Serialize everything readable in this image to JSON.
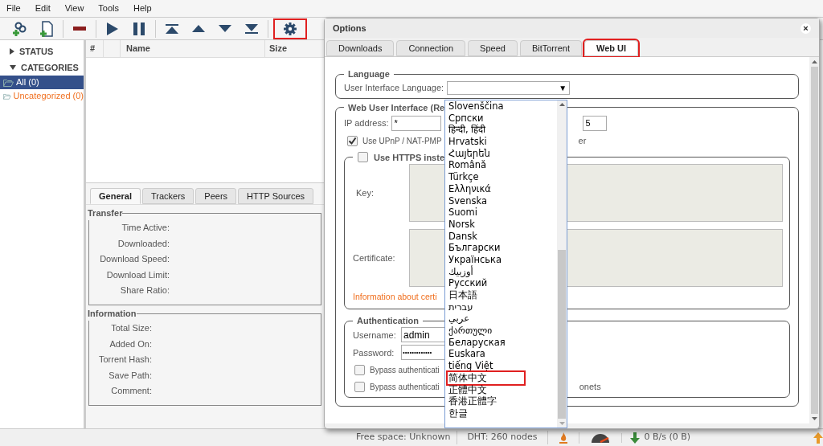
{
  "menu": [
    "File",
    "Edit",
    "View",
    "Tools",
    "Help"
  ],
  "toolbar": [
    [
      {
        "kind": "add-link",
        "highlighted": false
      },
      {
        "kind": "add-file",
        "highlighted": false
      }
    ],
    [
      {
        "kind": "remove",
        "highlighted": false
      }
    ],
    [
      {
        "kind": "play",
        "highlighted": false
      },
      {
        "kind": "pause",
        "highlighted": false
      }
    ],
    [
      {
        "kind": "top",
        "highlighted": false
      },
      {
        "kind": "up",
        "highlighted": false
      },
      {
        "kind": "down",
        "highlighted": false
      },
      {
        "kind": "bottom",
        "highlighted": false
      }
    ],
    [
      {
        "kind": "settings",
        "highlighted": true
      }
    ]
  ],
  "sidebar": {
    "sections": [
      {
        "label": "STATUS",
        "expanded": false
      },
      {
        "label": "CATEGORIES",
        "expanded": true
      }
    ],
    "items": [
      {
        "label": "All (0)",
        "selected": true
      },
      {
        "label": "Uncategorized (0)",
        "selected": false
      }
    ]
  },
  "table": {
    "columns": [
      "#",
      "Name",
      "Size"
    ]
  },
  "details": {
    "tabs": [
      {
        "label": "General",
        "selected": true
      },
      {
        "label": "Trackers",
        "selected": false
      },
      {
        "label": "Peers",
        "selected": false
      },
      {
        "label": "HTTP Sources",
        "selected": false
      }
    ],
    "groups": [
      {
        "title": "Transfer",
        "fields": [
          "Time Active:",
          "Downloaded:",
          "Download Speed:",
          "Download Limit:",
          "Share Ratio:"
        ]
      },
      {
        "title": "Information",
        "fields": [
          "Total Size:",
          "Added On:",
          "Torrent Hash:",
          "Save Path:",
          "Comment:"
        ]
      }
    ]
  },
  "dialog": {
    "title": "Options",
    "close": "×",
    "tabs": [
      {
        "label": "Downloads",
        "selected": false,
        "highlighted": false
      },
      {
        "label": "Connection",
        "selected": false,
        "highlighted": false
      },
      {
        "label": "Speed",
        "selected": false,
        "highlighted": false
      },
      {
        "label": "BitTorrent",
        "selected": false,
        "highlighted": false
      },
      {
        "label": "Web UI",
        "selected": true,
        "highlighted": true
      }
    ],
    "language": {
      "legend": "Language",
      "label": "User Interface Language:",
      "caret": "▼"
    },
    "webui": {
      "legend": "Web User Interface (Re",
      "ip_label": "IP address:",
      "ip_value": "*",
      "port_value": "5",
      "upnp": {
        "label": "Use UPnP / NAT-PMP",
        "tail": "er",
        "checked": true
      },
      "https": {
        "label": "Use HTTPS inste",
        "checked": false
      },
      "key_label": "Key:",
      "cert_label": "Certificate:",
      "info_link": "Information about certi"
    },
    "auth": {
      "legend": "Authentication",
      "username_label": "Username:",
      "username": "admin",
      "password_label": "Password:",
      "password": "•••••••••••••",
      "bypass": [
        {
          "label": "Bypass authenticati",
          "checked": false
        },
        {
          "label": "Bypass authenticati",
          "tail": "onets",
          "checked": false
        }
      ]
    },
    "language_options": [
      {
        "label": "Slovenščina",
        "highlighted": false
      },
      {
        "label": "Српски",
        "highlighted": false
      },
      {
        "label": "हिन्दी, हिंदी",
        "highlighted": false
      },
      {
        "label": "Hrvatski",
        "highlighted": false
      },
      {
        "label": "Հայերեն",
        "highlighted": false
      },
      {
        "label": "Română",
        "highlighted": false
      },
      {
        "label": "Türkçe",
        "highlighted": false
      },
      {
        "label": "Ελληνικά",
        "highlighted": false
      },
      {
        "label": "Svenska",
        "highlighted": false
      },
      {
        "label": "Suomi",
        "highlighted": false
      },
      {
        "label": "Norsk",
        "highlighted": false
      },
      {
        "label": "Dansk",
        "highlighted": false
      },
      {
        "label": "Български",
        "highlighted": false
      },
      {
        "label": "Українська",
        "highlighted": false
      },
      {
        "label": "أوزبيك",
        "highlighted": false
      },
      {
        "label": "Русский",
        "highlighted": false
      },
      {
        "label": "日本語",
        "highlighted": false
      },
      {
        "label": "עברית",
        "highlighted": false
      },
      {
        "label": "عربي",
        "highlighted": false
      },
      {
        "label": "ქართული",
        "highlighted": false
      },
      {
        "label": "Беларуская",
        "highlighted": false
      },
      {
        "label": "Euskara",
        "highlighted": false
      },
      {
        "label": "tiếng Việt",
        "highlighted": false
      },
      {
        "label": "简体中文",
        "highlighted": true
      },
      {
        "label": "正體中文",
        "highlighted": false
      },
      {
        "label": "香港正體字",
        "highlighted": false
      },
      {
        "label": "한글",
        "highlighted": false
      }
    ]
  },
  "status_bar": {
    "free_space": "Free space: Unknown",
    "dht": "DHT: 260 nodes",
    "download": "0 B/s (0 B)"
  }
}
